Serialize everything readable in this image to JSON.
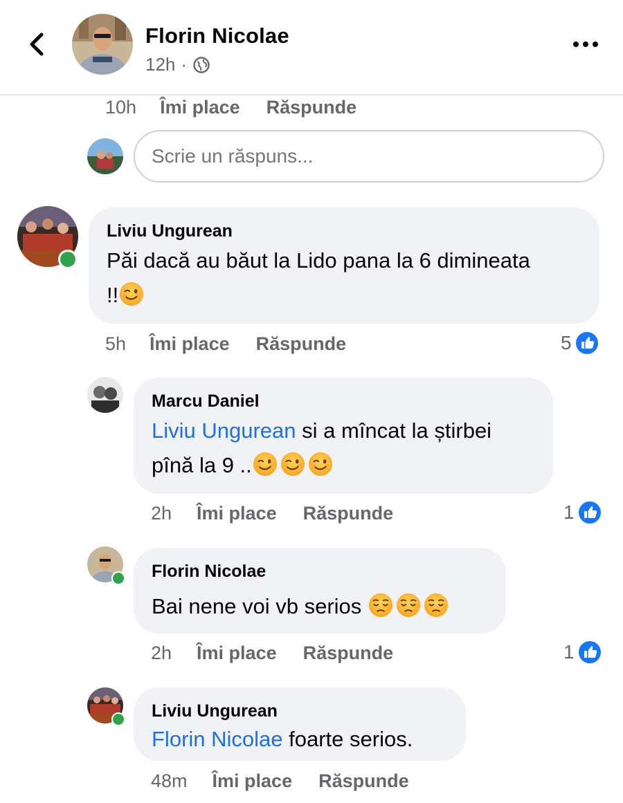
{
  "header": {
    "name": "Florin Nicolae",
    "time": "12h",
    "separator": "·"
  },
  "prev_actions": {
    "time": "10h",
    "like": "Îmi place",
    "reply": "Răspunde"
  },
  "reply_box": {
    "placeholder": "Scrie un răspuns..."
  },
  "comments": [
    {
      "author": "Liviu Ungurean",
      "line1": "Păi dacă au băut la Lido pana la 6 dimineata",
      "line2": "!!",
      "time": "5h",
      "like": "Îmi place",
      "reply": "Răspunde",
      "reactions": "5"
    },
    {
      "author": "Marcu Daniel",
      "mention": "Liviu Ungurean",
      "line1": " si a mîncat la știrbei",
      "line2": "pînă la 9 ..",
      "time": "2h",
      "like": "Îmi place",
      "reply": "Răspunde",
      "reactions": "1"
    },
    {
      "author": "Florin Nicolae",
      "line1": "Bai nene voi vb serios ",
      "time": "2h",
      "like": "Îmi place",
      "reply": "Răspunde",
      "reactions": "1"
    },
    {
      "author": "Liviu Ungurean",
      "mention": "Florin Nicolae",
      "line1": " foarte serios.",
      "time": "48m",
      "like": "Îmi place",
      "reply": "Răspunde"
    }
  ],
  "icons": {
    "back": "chevron-left-icon",
    "globe": "globe-icon",
    "more": "more-dots-icon",
    "like": "like-thumb-icon",
    "wink": "winking-face-emoji",
    "pensive": "pensive-face-emoji"
  },
  "colors": {
    "link": "#216fdb",
    "like_blue": "#1877f2",
    "online": "#31a24c",
    "bubble": "#f0f2f5"
  }
}
